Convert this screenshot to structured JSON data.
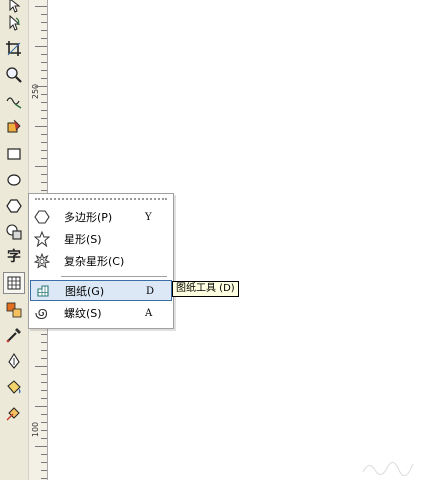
{
  "toolbox": {
    "items": [
      {
        "name": "pick-tool",
        "icon": "arrow-icon"
      },
      {
        "name": "shape-tool",
        "icon": "shape-edit-icon"
      },
      {
        "name": "crop-tool",
        "icon": "crop-icon"
      },
      {
        "name": "zoom-tool",
        "icon": "magnifier-icon"
      },
      {
        "name": "freehand-tool",
        "icon": "freehand-curve-icon"
      },
      {
        "name": "smart-fill-tool",
        "icon": "smart-fill-icon"
      },
      {
        "name": "rectangle-tool",
        "icon": "rectangle-icon"
      },
      {
        "name": "ellipse-tool",
        "icon": "ellipse-icon"
      },
      {
        "name": "polygon-tool",
        "icon": "polygon-icon"
      },
      {
        "name": "basic-shapes-tool",
        "icon": "basic-shapes-icon"
      },
      {
        "name": "text-tool",
        "icon": "text-icon",
        "glyph": "字"
      },
      {
        "name": "graph-paper-tool",
        "icon": "graph-paper-icon",
        "active": true
      },
      {
        "name": "interactive-tool",
        "icon": "interactive-blend-icon"
      },
      {
        "name": "eyedropper-tool",
        "icon": "eyedropper-icon"
      },
      {
        "name": "outline-tool",
        "icon": "pen-nib-icon"
      },
      {
        "name": "fill-tool",
        "icon": "paint-bucket-icon"
      },
      {
        "name": "interactive-fill-tool",
        "icon": "interactive-fill-icon"
      }
    ]
  },
  "ruler": {
    "labels": [
      "250",
      "100"
    ]
  },
  "flyout": {
    "items": [
      {
        "label": "多边形(P)",
        "shortcut": "Y",
        "icon": "polygon-icon"
      },
      {
        "label": "星形(S)",
        "shortcut": "",
        "icon": "star-icon"
      },
      {
        "label": "复杂星形(C)",
        "shortcut": "",
        "icon": "complex-star-icon"
      },
      {
        "label": "图纸(G)",
        "shortcut": "D",
        "icon": "graph-paper-icon",
        "highlighted": true
      },
      {
        "label": "螺纹(S)",
        "shortcut": "A",
        "icon": "spiral-icon"
      }
    ]
  },
  "tooltip": {
    "text": "图纸工具 (D)"
  },
  "colors": {
    "toolbox_bg": "#ece9d8",
    "highlight_bg": "#dde8f6",
    "highlight_border": "#3a6ea5",
    "tooltip_bg": "#ffffe1"
  }
}
